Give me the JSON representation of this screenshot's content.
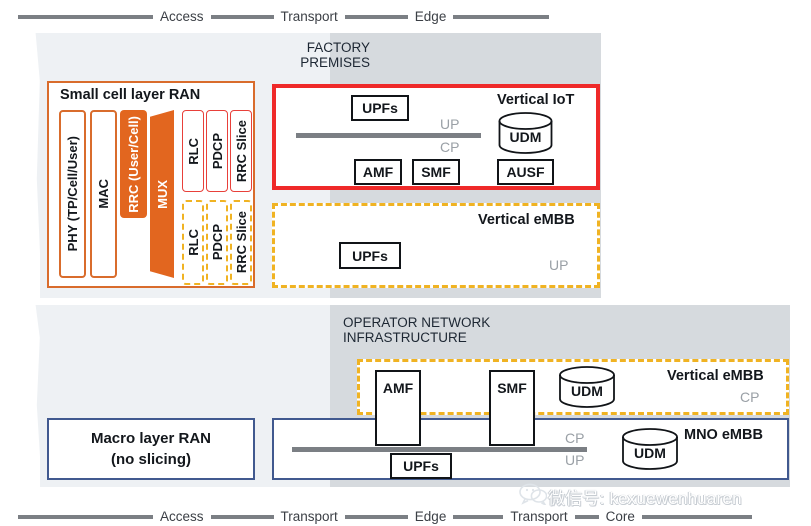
{
  "diagram": {
    "title_top_scale": [
      "Access",
      "Transport",
      "Edge"
    ],
    "title_bottom_scale": [
      "Access",
      "Transport",
      "Edge",
      "Transport",
      "Core"
    ],
    "factory_label": "FACTORY\nPREMISES",
    "operator_label": "OPERATOR NETWORK\nINFRASTRUCTURE"
  },
  "ran": {
    "title": "Small cell layer RAN",
    "solid_layers": [
      {
        "label": "PHY (TP/Cell/User)",
        "style": "orange-outline"
      },
      {
        "label": "MAC",
        "style": "orange-outline"
      },
      {
        "label": "RRC (User/Cell)",
        "style": "orange-filled"
      },
      {
        "label": "MUX",
        "style": "orange-mux"
      },
      {
        "label": "RLC",
        "style": "red-outline"
      },
      {
        "label": "PDCP",
        "style": "red-outline"
      },
      {
        "label": "RRC Slice",
        "style": "red-outline"
      }
    ],
    "dashed_layers": [
      {
        "label": "RLC"
      },
      {
        "label": "PDCP"
      },
      {
        "label": "RRC Slice"
      }
    ]
  },
  "vertical_iot": {
    "title": "Vertical IoT",
    "up_label": "UP",
    "cp_label": "CP",
    "functions": [
      "UPFs",
      "AMF",
      "SMF",
      "AUSF"
    ],
    "udm": "UDM",
    "border_color": "#ef2929"
  },
  "vertical_embb_edge": {
    "title": "Vertical eMBB",
    "up_label": "UP",
    "functions": [
      "UPFs"
    ],
    "border_color": "#f0b323"
  },
  "vertical_embb_core": {
    "title": "Vertical eMBB",
    "cp_label": "CP",
    "functions": [
      "AMF",
      "SMF"
    ],
    "udm": "UDM",
    "border_color": "#f0b323"
  },
  "macro_ran": {
    "line1": "Macro layer RAN",
    "line2": "(no slicing)",
    "border_color": "#41598f"
  },
  "mno_embb": {
    "title": "MNO eMBB",
    "cp_label": "CP",
    "up_label": "UP",
    "functions": [
      "UPFs"
    ],
    "udm": "UDM",
    "border_color": "#41598f"
  },
  "watermark": {
    "text": "微信号: kexuewenhuaren",
    "icon": "wechat-icon"
  },
  "colors": {
    "panel_light": "#eef1f4",
    "panel_dark": "#d6dade",
    "orange": "#d96c2c",
    "orange_fill": "#e2661f",
    "red": "#ef2929",
    "yellow": "#f0b323",
    "blue": "#41598f",
    "bus_gray": "#7b7f84"
  }
}
